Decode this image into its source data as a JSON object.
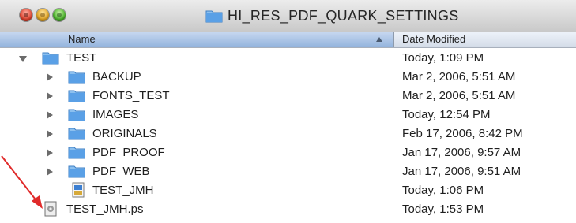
{
  "window": {
    "title": "HI_RES_PDF_QUARK_SETTINGS",
    "title_icon": "folder-icon"
  },
  "header": {
    "name_label": "Name",
    "date_label": "Date Modified",
    "sort": "ascending"
  },
  "rows": [
    {
      "name": "TEST",
      "date": "Today, 1:09 PM",
      "icon": "folder-icon",
      "disclosure": "expanded"
    },
    {
      "name": "BACKUP",
      "date": "Mar 2, 2006, 5:51 AM",
      "icon": "folder-icon",
      "disclosure": "collapsed"
    },
    {
      "name": "FONTS_TEST",
      "date": "Mar 2, 2006, 5:51 AM",
      "icon": "folder-icon",
      "disclosure": "collapsed"
    },
    {
      "name": "IMAGES",
      "date": "Today, 12:54 PM",
      "icon": "folder-icon",
      "disclosure": "collapsed"
    },
    {
      "name": "ORIGINALS",
      "date": "Feb 17, 2006, 8:42 PM",
      "icon": "folder-icon",
      "disclosure": "collapsed"
    },
    {
      "name": "PDF_PROOF",
      "date": "Jan 17, 2006, 9:57 AM",
      "icon": "folder-icon",
      "disclosure": "collapsed"
    },
    {
      "name": "PDF_WEB",
      "date": "Jan 17, 2006, 9:51 AM",
      "icon": "folder-icon",
      "disclosure": "collapsed"
    },
    {
      "name": "TEST_JMH",
      "date": "Today, 1:06 PM",
      "icon": "quark-document-icon",
      "disclosure": "none"
    },
    {
      "name": "TEST_JMH.ps",
      "date": "Today, 1:53 PM",
      "icon": "postscript-file-icon",
      "disclosure": "none"
    }
  ],
  "annotation": {
    "icon": "red-arrow-icon",
    "color": "#e02a2a"
  },
  "colors": {
    "header_sorted": "#93b3dd",
    "folder_blue": "#5aa0e6"
  }
}
